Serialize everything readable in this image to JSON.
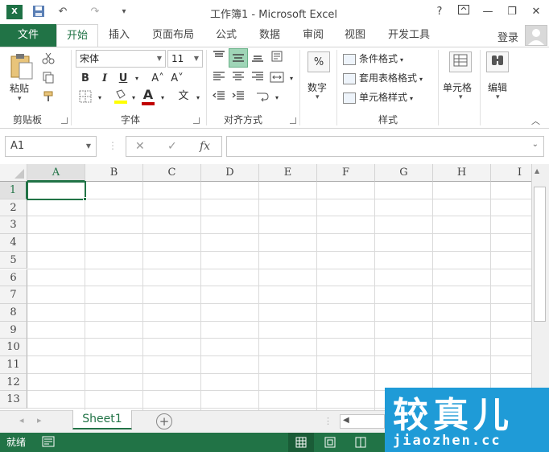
{
  "app": {
    "title": "工作簿1 - Microsoft Excel",
    "help": "?",
    "minimize": "—",
    "restore": "❐",
    "close": "✕",
    "logo": "X",
    "qa_undo": "↶",
    "qa_redo": "↷",
    "qa_customize": "▾"
  },
  "ribbon": {
    "file_tab": "文件",
    "tabs": [
      "开始",
      "插入",
      "页面布局",
      "公式",
      "数据",
      "审阅",
      "视图",
      "开发工具"
    ],
    "login": "登录",
    "clipboard": {
      "paste": "粘贴",
      "label": "剪贴板"
    },
    "font": {
      "name": "宋体",
      "size": "11",
      "bold": "B",
      "italic": "I",
      "underline": "U",
      "grow": "A˄",
      "shrink": "A˅",
      "color_letter": "A",
      "wen": "文",
      "label": "字体"
    },
    "alignment": {
      "label": "对齐方式"
    },
    "number": {
      "symbol": "%",
      "label": "数字"
    },
    "styles": {
      "conditional": "条件格式",
      "table": "套用表格格式",
      "cell": "单元格样式",
      "label": "样式"
    },
    "cells": {
      "label": "单元格"
    },
    "editing": {
      "label": "编辑"
    }
  },
  "formula_bar": {
    "name_box": "A1",
    "cancel": "✕",
    "enter": "✓",
    "fx": "fx",
    "value": ""
  },
  "grid": {
    "columns": [
      "A",
      "B",
      "C",
      "D",
      "E",
      "F",
      "G",
      "H",
      "I"
    ],
    "rows": [
      "1",
      "2",
      "3",
      "4",
      "5",
      "6",
      "7",
      "8",
      "9",
      "10",
      "11",
      "12",
      "13"
    ],
    "active_cell": "A1"
  },
  "sheets": {
    "tabs": [
      "Sheet1"
    ],
    "add": "+",
    "prev": "◂",
    "next": "▸"
  },
  "status": {
    "ready": "就绪"
  },
  "watermark": {
    "text": "较真儿",
    "url": "jiaozhen.cc"
  },
  "colors": {
    "accent": "#217346",
    "watermark": "#1f9bd7"
  }
}
